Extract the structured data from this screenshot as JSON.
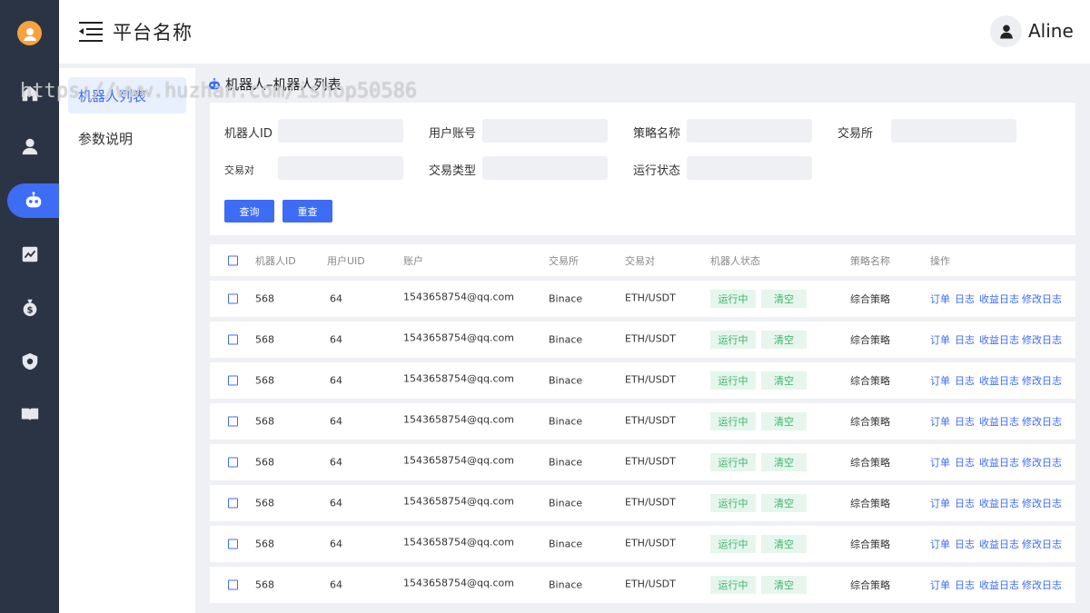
{
  "header": {
    "title": "平台名称",
    "user_name": "Aline"
  },
  "subnav": {
    "items": [
      {
        "label": "机器人列表",
        "active": true
      },
      {
        "label": "参数说明",
        "active": false
      }
    ]
  },
  "rail_icons": [
    "home-icon",
    "user-icon",
    "robot-icon",
    "chart-icon",
    "money-bag-icon",
    "shield-icon",
    "book-icon"
  ],
  "page": {
    "title": "机器人–机器人列表"
  },
  "filter": {
    "robot_id_label": "机器人ID",
    "user_account_label": "用户账号",
    "strategy_name_label": "策略名称",
    "exchange_label": "交易所",
    "pair_label": "交易对",
    "trade_type_label": "交易类型",
    "run_status_label": "运行状态",
    "query_label": "查询",
    "reset_label": "重查"
  },
  "table": {
    "columns": [
      "机器人ID",
      "用户UID",
      "账户",
      "交易所",
      "交易对",
      "机器人状态",
      "策略名称",
      "操作"
    ],
    "rows": [
      {
        "id": "568",
        "uid": "64",
        "account": "1543658754@qq.com",
        "exchange": "Binace",
        "pair": "ETH/USDT",
        "status": "运行中",
        "clear": "清空",
        "strategy": "综合策略"
      },
      {
        "id": "568",
        "uid": "64",
        "account": "1543658754@qq.com",
        "exchange": "Binace",
        "pair": "ETH/USDT",
        "status": "运行中",
        "clear": "清空",
        "strategy": "综合策略"
      },
      {
        "id": "568",
        "uid": "64",
        "account": "1543658754@qq.com",
        "exchange": "Binace",
        "pair": "ETH/USDT",
        "status": "运行中",
        "clear": "清空",
        "strategy": "综合策略"
      },
      {
        "id": "568",
        "uid": "64",
        "account": "1543658754@qq.com",
        "exchange": "Binace",
        "pair": "ETH/USDT",
        "status": "运行中",
        "clear": "清空",
        "strategy": "综合策略"
      },
      {
        "id": "568",
        "uid": "64",
        "account": "1543658754@qq.com",
        "exchange": "Binace",
        "pair": "ETH/USDT",
        "status": "运行中",
        "clear": "清空",
        "strategy": "综合策略"
      },
      {
        "id": "568",
        "uid": "64",
        "account": "1543658754@qq.com",
        "exchange": "Binace",
        "pair": "ETH/USDT",
        "status": "运行中",
        "clear": "清空",
        "strategy": "综合策略"
      },
      {
        "id": "568",
        "uid": "64",
        "account": "1543658754@qq.com",
        "exchange": "Binace",
        "pair": "ETH/USDT",
        "status": "运行中",
        "clear": "清空",
        "strategy": "综合策略"
      },
      {
        "id": "568",
        "uid": "64",
        "account": "1543658754@qq.com",
        "exchange": "Binace",
        "pair": "ETH/USDT",
        "status": "运行中",
        "clear": "清空",
        "strategy": "综合策略"
      }
    ],
    "actions": [
      "订单",
      "日志",
      "收益日志",
      "修改日志"
    ]
  },
  "watermark": "https://www.huzhan.com/ishop50586",
  "colors": {
    "accent": "#3d6cf5",
    "rail": "#2b3445",
    "status_bg": "#e6f6ec",
    "status_text": "#3cb46b"
  }
}
